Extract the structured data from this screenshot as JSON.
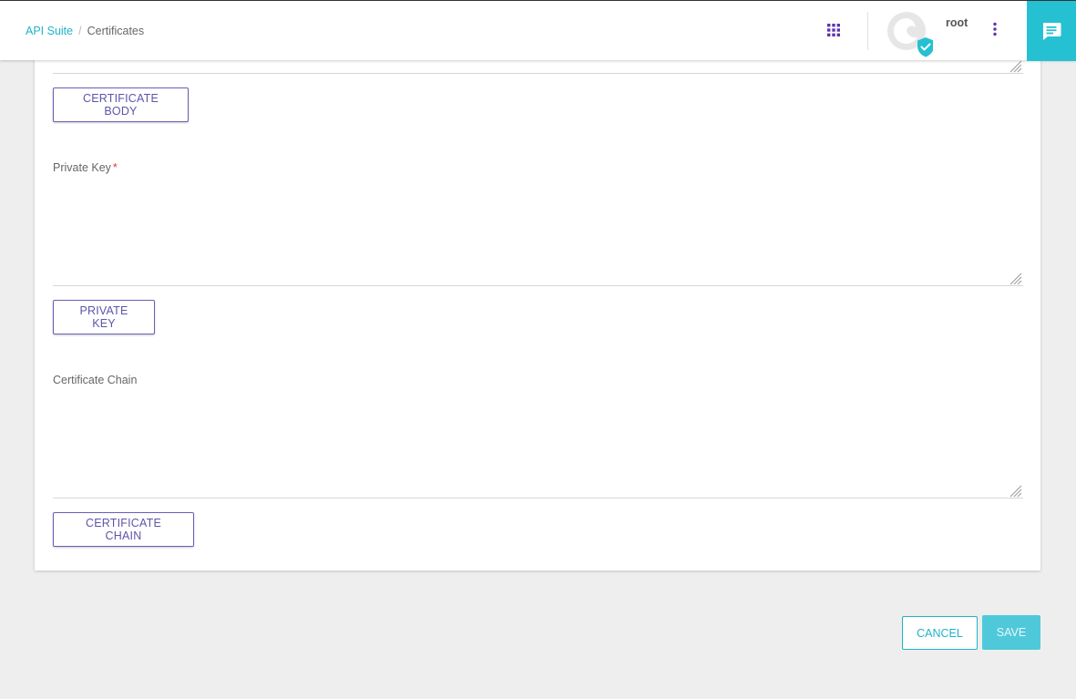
{
  "header": {
    "breadcrumb": {
      "root": "API Suite",
      "separator": "/",
      "current": "Certificates"
    },
    "user": {
      "name": "root"
    },
    "icons": {
      "apps": "apps-grid-icon",
      "more": "more-vert-icon",
      "chat": "chat-icon",
      "verified": "verified-badge-icon"
    }
  },
  "form": {
    "certificate_body": {
      "button_label": "CERTIFICATE BODY",
      "value": ""
    },
    "private_key": {
      "label": "Private Key",
      "required_mark": "*",
      "value": "",
      "button_label": "PRIVATE KEY"
    },
    "certificate_chain": {
      "label": "Certificate Chain",
      "value": "",
      "button_label": "CERTIFICATE CHAIN"
    }
  },
  "actions": {
    "cancel": "CANCEL",
    "save": "SAVE"
  },
  "colors": {
    "accent": "#1fb3c8",
    "purple": "#6a5fb8",
    "required": "#e53935"
  }
}
